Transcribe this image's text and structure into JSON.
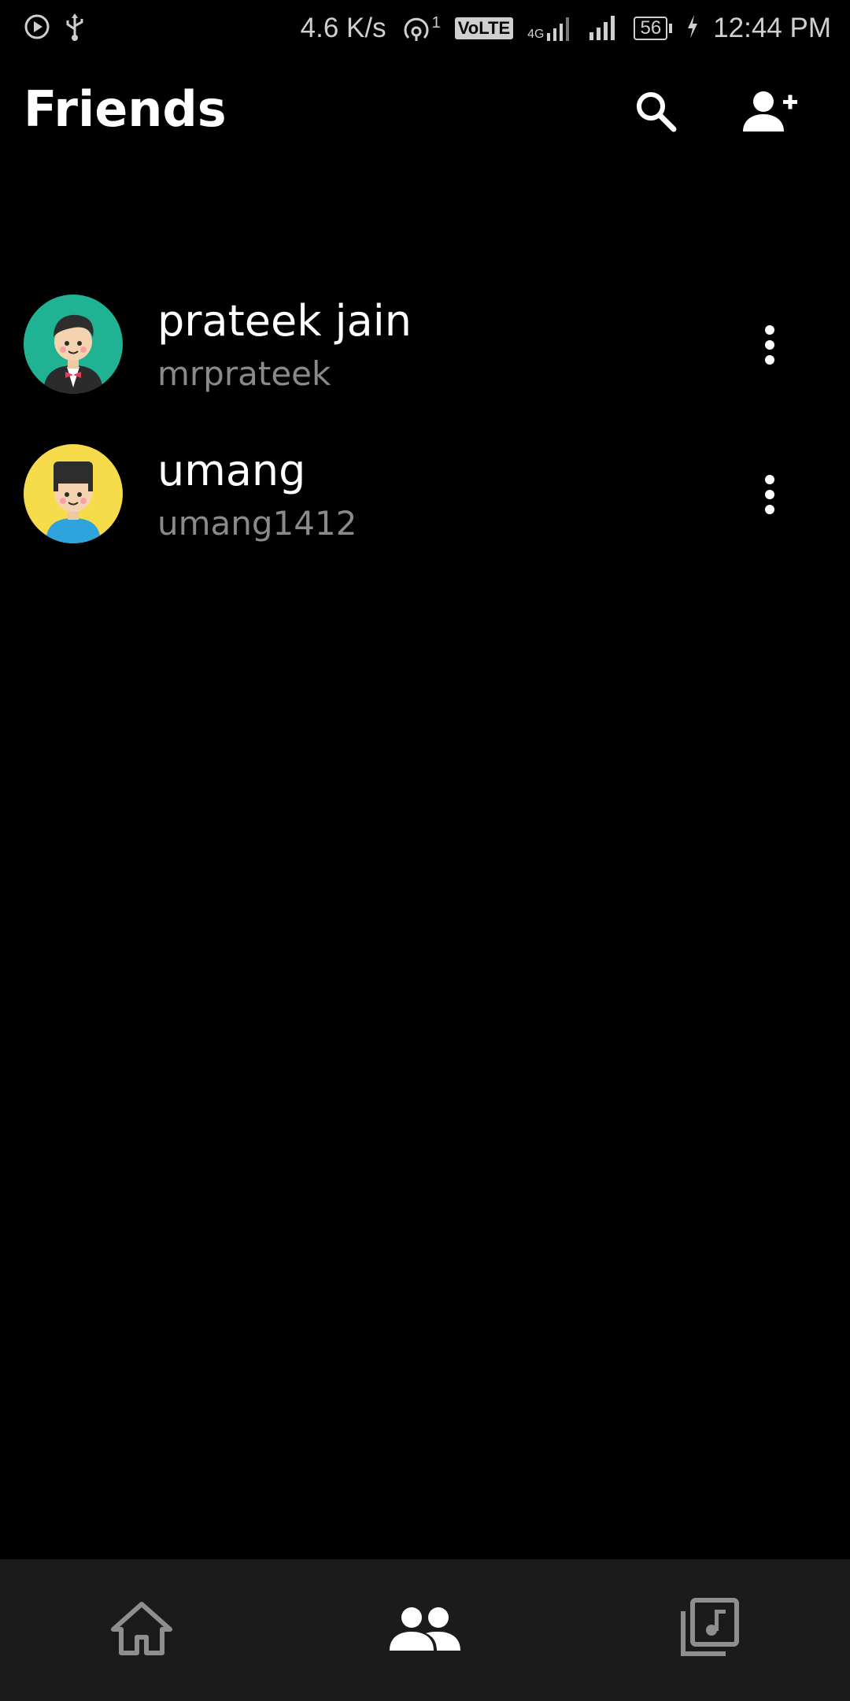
{
  "status_bar": {
    "net_speed": "4.6 K/s",
    "hotspot_sup": "1",
    "volte": "VoLTE",
    "network_type": "4G",
    "battery_level": "56",
    "time": "12:44 PM"
  },
  "header": {
    "title": "Friends",
    "icons": [
      "search-icon",
      "add-person-icon"
    ]
  },
  "friends": [
    {
      "name": "prateek jain",
      "username": "mrprateek",
      "avatar_bg": "#1fb394"
    },
    {
      "name": "umang",
      "username": "umang1412",
      "avatar_bg": "#f6dc4a"
    }
  ],
  "bottom_nav": {
    "items": [
      {
        "icon": "home-icon",
        "active": false
      },
      {
        "icon": "friends-icon",
        "active": true
      },
      {
        "icon": "music-library-icon",
        "active": false
      }
    ],
    "active_color": "#ffffff",
    "inactive_color": "#8e8e8e"
  },
  "colors": {
    "background": "#000000",
    "nav_background": "#1b1b1b",
    "secondary_text": "#8a8a8a"
  }
}
